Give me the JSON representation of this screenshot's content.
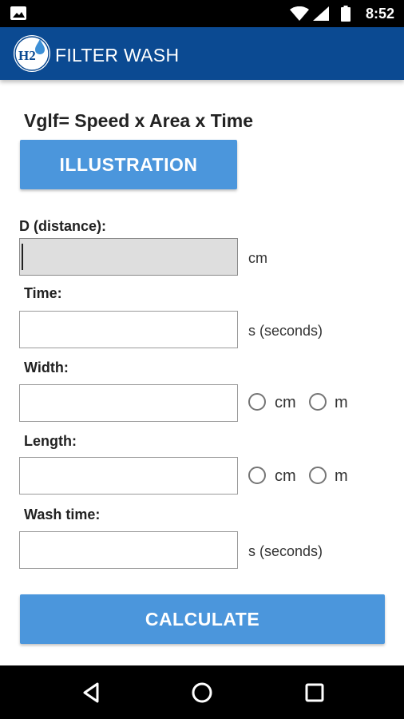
{
  "status_bar": {
    "time": "8:52"
  },
  "app": {
    "title": "FILTER WASH",
    "logo_text": "H2O"
  },
  "formula": "Vglf= Speed x Area x Time",
  "buttons": {
    "illustration": "ILLUSTRATION",
    "calculate": "CALCULATE"
  },
  "fields": {
    "distance": {
      "label": "D (distance):",
      "value": "",
      "unit": "cm"
    },
    "time": {
      "label": "Time:",
      "value": "",
      "unit": "s (seconds)"
    },
    "width": {
      "label": "Width:",
      "value": "",
      "options": [
        "cm",
        "m"
      ],
      "selected": null
    },
    "length": {
      "label": "Length:",
      "value": "",
      "options": [
        "cm",
        "m"
      ],
      "selected": null
    },
    "wash_time": {
      "label": "Wash time:",
      "value": "",
      "unit": "s (seconds)"
    }
  },
  "colors": {
    "app_bar": "#0b4a92",
    "button": "#4b96dc",
    "disabled_field": "#dedede"
  },
  "icons": {
    "status": [
      "image-icon",
      "wifi-icon",
      "signal-icon",
      "battery-icon"
    ],
    "nav": [
      "back-icon",
      "home-icon",
      "recents-icon"
    ]
  }
}
